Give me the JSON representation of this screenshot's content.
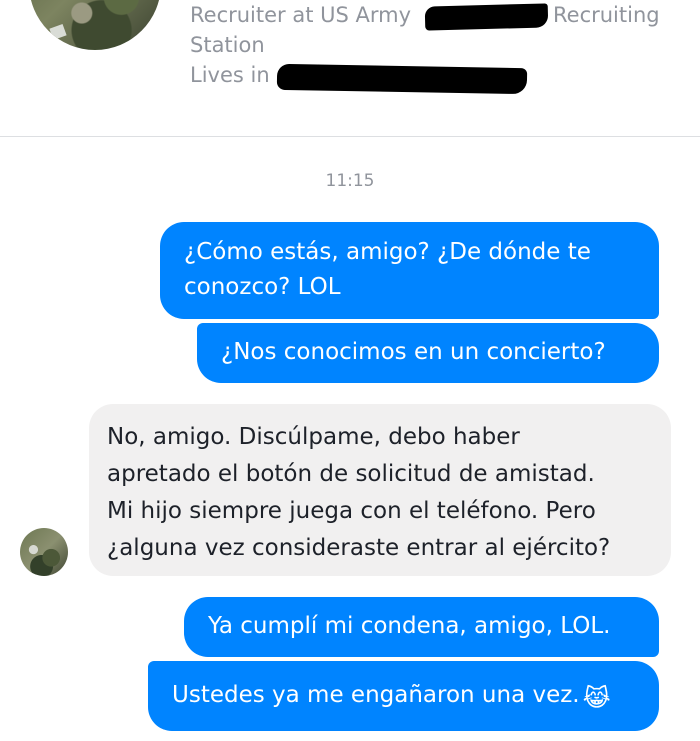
{
  "profile": {
    "job_prefix": "Recruiter at US Army",
    "job_suffix": "Recruiting",
    "job_line2": "Station",
    "lives_in_label": "Lives in"
  },
  "conversation": {
    "timestamp": "11:15",
    "messages": [
      {
        "from": "me",
        "lines": [
          "¿Cómo estás, amigo? ¿De dónde te",
          "conozco? LOL"
        ]
      },
      {
        "from": "me",
        "lines": [
          "¿Nos conocimos en un concierto?"
        ]
      },
      {
        "from": "them",
        "lines": [
          "No, amigo. Discúlpame, debo haber",
          "apretado el botón de solicitud de amistad.",
          "Mi hijo siempre juega con el teléfono. Pero",
          "¿alguna vez consideraste entrar al ejército?"
        ]
      },
      {
        "from": "me",
        "lines": [
          "Ya cumplí mi condena, amigo, LOL."
        ]
      },
      {
        "from": "me",
        "lines": [
          "Ustedes ya me engañaron una vez."
        ],
        "emoji": "😹"
      }
    ]
  },
  "colors": {
    "outgoing_bubble": "#0084ff",
    "incoming_bubble": "#f1f0f0",
    "secondary_text": "#90949c"
  },
  "icons": {
    "profile_avatar": "soldier-photo",
    "sender_avatar": "soldier-photo",
    "emoji": "crying-laughing-cat-emoji"
  }
}
